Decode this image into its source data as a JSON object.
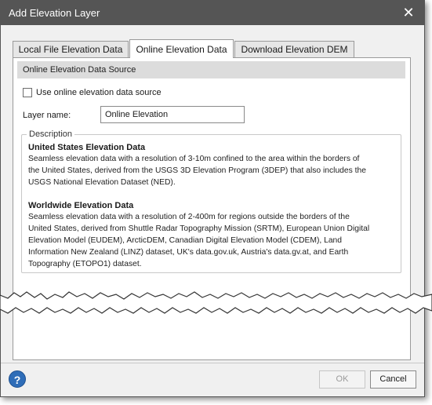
{
  "window": {
    "title": "Add Elevation Layer",
    "close_icon": "close-icon"
  },
  "tabs": [
    {
      "label": "Local File Elevation Data",
      "active": false
    },
    {
      "label": "Online Elevation Data",
      "active": true
    },
    {
      "label": "Download Elevation DEM",
      "active": false
    }
  ],
  "section": {
    "header": "Online Elevation Data Source"
  },
  "checkbox": {
    "label": "Use online elevation data source",
    "checked": false
  },
  "layer": {
    "label": "Layer name:",
    "value": "Online Elevation"
  },
  "description": {
    "legend": "Description",
    "blocks": [
      {
        "title": "United States Elevation Data",
        "lines": [
          "Seamless elevation data with a resolution of 3-10m confined to the area within the borders of",
          "the United States, derived from the USGS 3D Elevation Program (3DEP) that also includes the",
          "USGS National Elevation Dataset (NED)."
        ]
      },
      {
        "title": "Worldwide Elevation Data",
        "lines": [
          "Seamless elevation data with a resolution of 2-400m for regions outside the borders of the",
          "United States, derived from Shuttle Radar Topography Mission (SRTM), European Union Digital",
          "Elevation Model (EUDEM), ArcticDEM, Canadian Digital Elevation Model (CDEM), Land",
          "Information New Zealand (LINZ) dataset, UK's data.gov.uk, Austria's data.gv.at, and Earth",
          "Topography (ETOPO1) dataset."
        ]
      }
    ]
  },
  "footer": {
    "help_icon": "help-icon",
    "help_glyph": "?",
    "ok_label": "OK",
    "ok_enabled": false,
    "cancel_label": "Cancel"
  },
  "colors": {
    "titlebar": "#555555",
    "tab_active": "#ffffff",
    "help_blue": "#2f6db8"
  }
}
